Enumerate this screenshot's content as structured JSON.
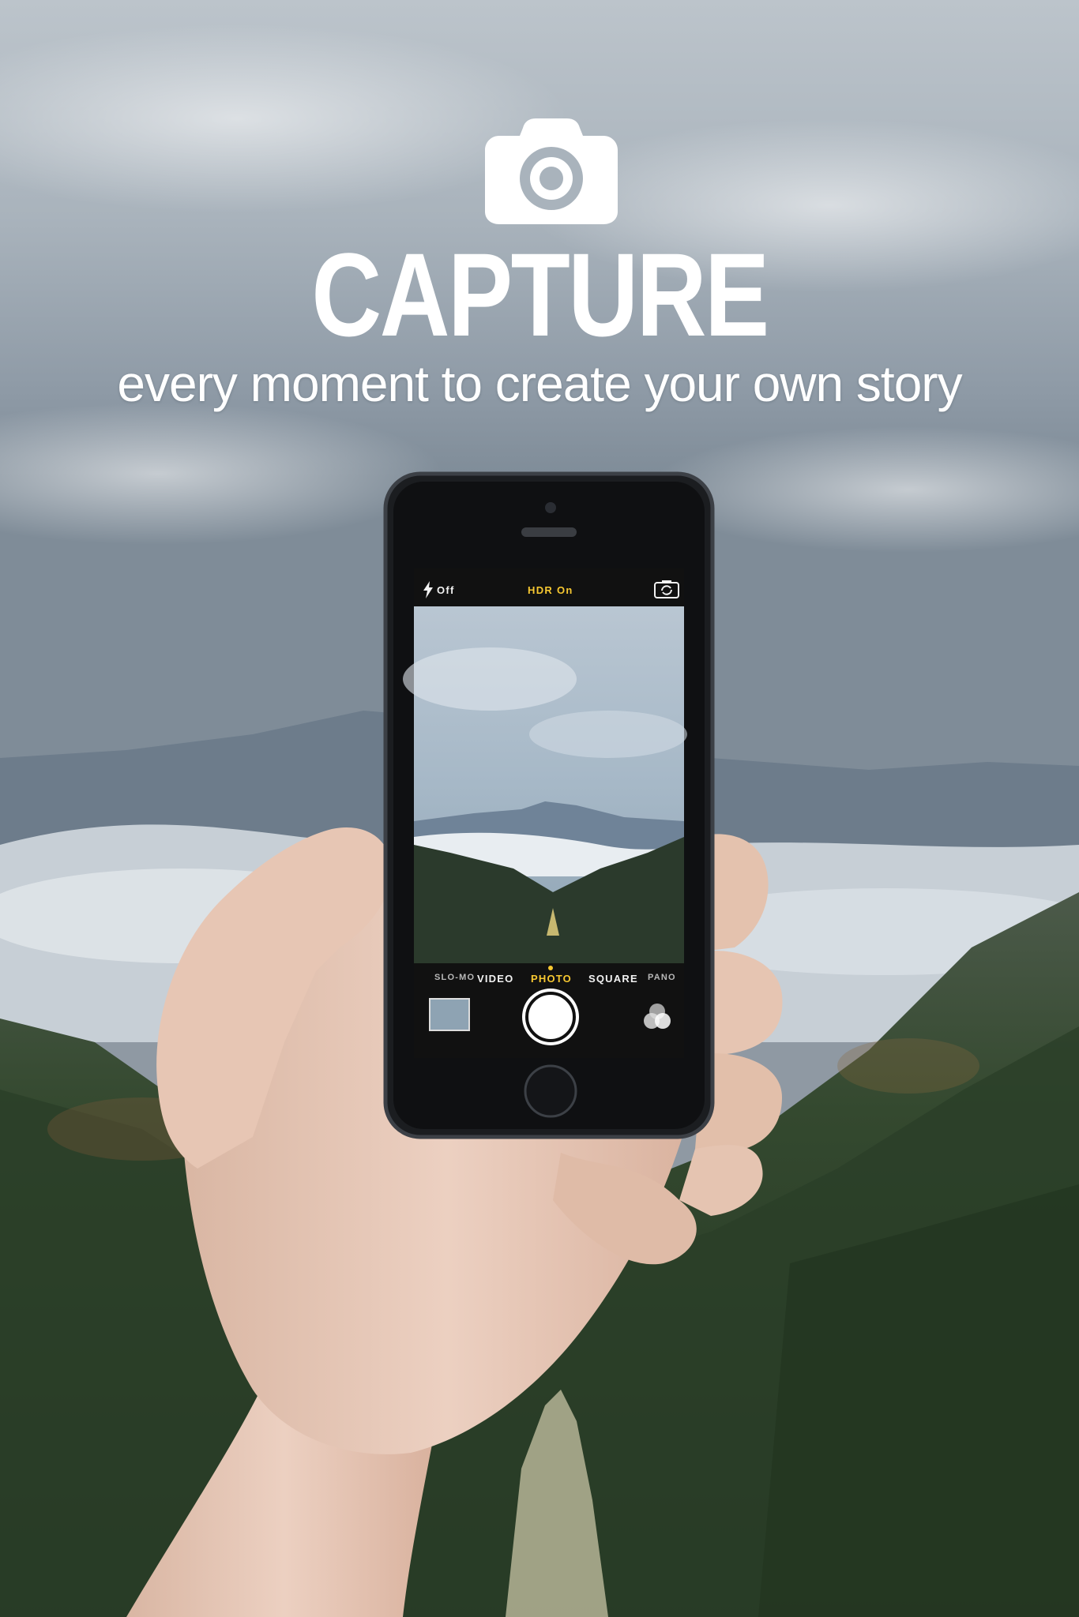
{
  "hero": {
    "icon": "camera-icon",
    "title": "CAPTURE",
    "subtitle": "every moment to create your own story"
  },
  "phone_camera_ui": {
    "flash_label": "Off",
    "flash_icon": "lightning-bolt-icon",
    "hdr_label": "HDR On",
    "switch_camera_icon": "switch-camera-icon",
    "modes": [
      "SLO-MO",
      "VIDEO",
      "PHOTO",
      "SQUARE",
      "PANO"
    ],
    "selected_mode": "PHOTO",
    "filters_icon": "filters-icon",
    "accent_color": "#f7c831"
  },
  "colors": {
    "sky": "#a9b3bc",
    "forest": "#2f4630",
    "text": "#ffffff"
  }
}
